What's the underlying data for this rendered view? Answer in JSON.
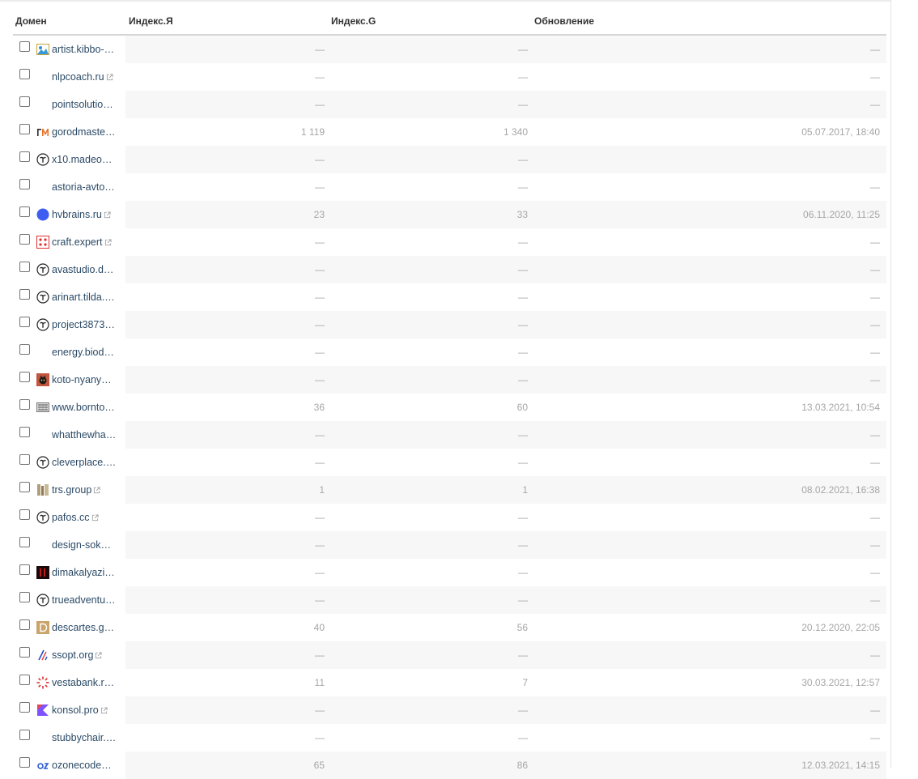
{
  "columns": {
    "domain": "Домен",
    "yandex": "Индекс.Я",
    "google": "Индекс.G",
    "update": "Обновление"
  },
  "rows": [
    {
      "domain": "artist.kibbo-…",
      "icon": "landscape-icon",
      "external": false,
      "ya": "—",
      "g": "—",
      "update": "—"
    },
    {
      "domain": "nlpcoach.ru",
      "icon": "none",
      "external": true,
      "ya": "—",
      "g": "—",
      "update": "—"
    },
    {
      "domain": "pointsolutio…",
      "icon": "none",
      "external": false,
      "ya": "—",
      "g": "—",
      "update": "—"
    },
    {
      "domain": "gorodmaste…",
      "icon": "gm-logo-icon",
      "external": false,
      "ya": "1 119",
      "g": "1 340",
      "update": "05.07.2017, 18:40"
    },
    {
      "domain": "x10.madeo…",
      "icon": "tilda-icon",
      "external": false,
      "ya": "—",
      "g": "—",
      "update": ""
    },
    {
      "domain": "astoria-avto…",
      "icon": "none",
      "external": false,
      "ya": "—",
      "g": "—",
      "update": "—"
    },
    {
      "domain": "hvbrains.ru",
      "icon": "blue-circle-icon",
      "external": true,
      "ya": "23",
      "g": "33",
      "update": "06.11.2020, 11:25"
    },
    {
      "domain": "craft.expert",
      "icon": "craft-icon",
      "external": true,
      "ya": "—",
      "g": "—",
      "update": "—"
    },
    {
      "domain": "avastudio.d…",
      "icon": "tilda-icon",
      "external": false,
      "ya": "—",
      "g": "—",
      "update": "—"
    },
    {
      "domain": "arinart.tilda.…",
      "icon": "tilda-icon",
      "external": false,
      "ya": "—",
      "g": "—",
      "update": "—"
    },
    {
      "domain": "project3873…",
      "icon": "tilda-icon",
      "external": false,
      "ya": "—",
      "g": "—",
      "update": "—"
    },
    {
      "domain": "energy.biod…",
      "icon": "none",
      "external": false,
      "ya": "—",
      "g": "—",
      "update": "—"
    },
    {
      "domain": "koto-nyany…",
      "icon": "cat-icon",
      "external": false,
      "ya": "—",
      "g": "—",
      "update": "—"
    },
    {
      "domain": "www.bornto…",
      "icon": "grid-logo-icon",
      "external": false,
      "ya": "36",
      "g": "60",
      "update": "13.03.2021, 10:54"
    },
    {
      "domain": "whatthewha…",
      "icon": "none",
      "external": false,
      "ya": "—",
      "g": "—",
      "update": "—"
    },
    {
      "domain": "cleverplace.…",
      "icon": "tilda-icon",
      "external": false,
      "ya": "—",
      "g": "—",
      "update": "—"
    },
    {
      "domain": "trs.group",
      "icon": "trs-icon",
      "external": true,
      "ya": "1",
      "g": "1",
      "update": "08.02.2021, 16:38"
    },
    {
      "domain": "pafos.cc",
      "icon": "tilda-icon",
      "external": true,
      "ya": "—",
      "g": "—",
      "update": "—"
    },
    {
      "domain": "design-sok…",
      "icon": "none",
      "external": false,
      "ya": "—",
      "g": "—",
      "update": "—"
    },
    {
      "domain": "dimakalyazi…",
      "icon": "dark-logo-icon",
      "external": false,
      "ya": "—",
      "g": "—",
      "update": "—"
    },
    {
      "domain": "trueadventu…",
      "icon": "tilda-icon",
      "external": false,
      "ya": "—",
      "g": "—",
      "update": "—"
    },
    {
      "domain": "descartes.g…",
      "icon": "d-logo-icon",
      "external": false,
      "ya": "40",
      "g": "56",
      "update": "20.12.2020, 22:05"
    },
    {
      "domain": "ssopt.org",
      "icon": "ss-logo-icon",
      "external": true,
      "ya": "—",
      "g": "—",
      "update": "—"
    },
    {
      "domain": "vestabank.r…",
      "icon": "sun-icon",
      "external": false,
      "ya": "11",
      "g": "7",
      "update": "30.03.2021, 12:57"
    },
    {
      "domain": "konsol.pro",
      "icon": "kotlin-icon",
      "external": true,
      "ya": "—",
      "g": "—",
      "update": "—"
    },
    {
      "domain": "stubbychair.…",
      "icon": "none",
      "external": false,
      "ya": "—",
      "g": "—",
      "update": "—"
    },
    {
      "domain": "ozonecode…",
      "icon": "oz-icon",
      "external": false,
      "ya": "65",
      "g": "86",
      "update": "12.03.2021, 14:15"
    }
  ]
}
